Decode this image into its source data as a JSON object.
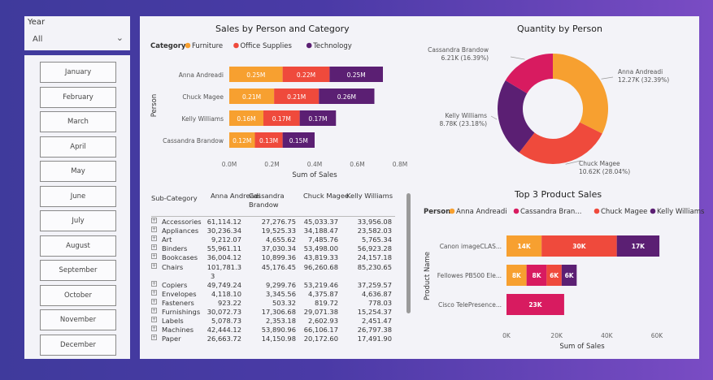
{
  "slicers": {
    "year": {
      "label": "Year",
      "selected": "All"
    },
    "months": [
      "January",
      "February",
      "March",
      "April",
      "May",
      "June",
      "July",
      "August",
      "September",
      "October",
      "November",
      "December"
    ]
  },
  "colors": {
    "furniture": "#f7a030",
    "office_supplies": "#ef4a3c",
    "technology": "#5b1f73",
    "anna": "#f7a030",
    "cassandra": "#d81b60",
    "chuck": "#ef4a3c",
    "kelly": "#5b1f73"
  },
  "table": {
    "headers": [
      "Sub-Category",
      "Anna Andreadi",
      "Cassandra Brandow",
      "Chuck Magee",
      "Kelly Williams"
    ],
    "rows": [
      [
        "Accessories",
        "61,114.12",
        "27,276.75",
        "45,033.37",
        "33,956.08"
      ],
      [
        "Appliances",
        "30,236.34",
        "19,525.33",
        "34,188.47",
        "23,582.03"
      ],
      [
        "Art",
        "9,212.07",
        "4,655.62",
        "7,485.76",
        "5,765.34"
      ],
      [
        "Binders",
        "55,961.11",
        "37,030.34",
        "53,498.00",
        "56,923.28"
      ],
      [
        "Bookcases",
        "36,004.12",
        "10,899.36",
        "43,819.33",
        "24,157.18"
      ],
      [
        "Chairs",
        "101,781.3",
        "45,176.45",
        "96,260.68",
        "85,230.65"
      ],
      [
        "",
        "3",
        "",
        "",
        ""
      ],
      [
        "Copiers",
        "49,749.24",
        "9,299.76",
        "53,219.46",
        "37,259.57"
      ],
      [
        "Envelopes",
        "4,118.10",
        "3,345.56",
        "4,375.87",
        "4,636.87"
      ],
      [
        "Fasteners",
        "923.22",
        "503.32",
        "819.72",
        "778.03"
      ],
      [
        "Furnishings",
        "30,072.73",
        "17,306.68",
        "29,071.38",
        "15,254.37"
      ],
      [
        "Labels",
        "5,078.73",
        "2,353.18",
        "2,602.93",
        "2,451.47"
      ],
      [
        "Machines",
        "42,444.12",
        "53,890.96",
        "66,106.17",
        "26,797.38"
      ],
      [
        "Paper",
        "26,663.72",
        "14,150.98",
        "20,172.60",
        "17,491.90"
      ]
    ]
  },
  "chart_data": [
    {
      "type": "bar",
      "orientation": "horizontal",
      "stacked": true,
      "title": "Sales by Person and Category",
      "legend_title": "Category",
      "legend_position": "top-left",
      "ylabel": "Person",
      "xlabel": "Sum of Sales",
      "categories": [
        "Anna Andreadi",
        "Chuck Magee",
        "Kelly Williams",
        "Cassandra Brandow"
      ],
      "series": [
        {
          "name": "Furniture",
          "values": [
            0.25,
            0.21,
            0.16,
            0.12
          ],
          "labels": [
            "0.25M",
            "0.21M",
            "0.16M",
            "0.12M"
          ]
        },
        {
          "name": "Office Supplies",
          "values": [
            0.22,
            0.21,
            0.17,
            0.13
          ],
          "labels": [
            "0.22M",
            "0.21M",
            "0.17M",
            "0.13M"
          ]
        },
        {
          "name": "Technology",
          "values": [
            0.25,
            0.26,
            0.17,
            0.15
          ],
          "labels": [
            "0.25M",
            "0.26M",
            "0.17M",
            "0.15M"
          ]
        }
      ],
      "xlim": [
        0,
        0.8
      ],
      "xticks": [
        "0.0M",
        "0.2M",
        "0.4M",
        "0.6M",
        "0.8M"
      ],
      "grid": false
    },
    {
      "type": "pie",
      "donut": true,
      "title": "Quantity by Person",
      "slices": [
        {
          "name": "Anna Andreadi",
          "value": 12.27,
          "label": "12.27K (32.39%)"
        },
        {
          "name": "Chuck Magee",
          "value": 10.62,
          "label": "10.62K (28.04%)"
        },
        {
          "name": "Kelly Williams",
          "value": 8.78,
          "label": "8.78K (23.18%)"
        },
        {
          "name": "Cassandra Brandow",
          "value": 6.21,
          "label": "6.21K (16.39%)"
        }
      ]
    },
    {
      "type": "bar",
      "orientation": "horizontal",
      "stacked": true,
      "title": "Top 3 Product Sales",
      "legend_title": "Person",
      "legend_position": "top-left",
      "legend_entries": [
        "Anna Andreadi",
        "Cassandra Bran...",
        "Chuck Magee",
        "Kelly Williams"
      ],
      "ylabel": "Product Name",
      "xlabel": "Sum of Sales",
      "categories": [
        "Canon imageCLAS...",
        "Fellowes PB500 Ele...",
        "Cisco TelePresence..."
      ],
      "segments": [
        [
          {
            "person": "Anna Andreadi",
            "value": 14,
            "label": "14K"
          },
          {
            "person": "Chuck Magee",
            "value": 30,
            "label": "30K"
          },
          {
            "person": "Kelly Williams",
            "value": 17,
            "label": "17K"
          }
        ],
        [
          {
            "person": "Anna Andreadi",
            "value": 8,
            "label": "8K"
          },
          {
            "person": "Cassandra Brandow",
            "value": 8,
            "label": "8K"
          },
          {
            "person": "Chuck Magee",
            "value": 6,
            "label": "6K"
          },
          {
            "person": "Kelly Williams",
            "value": 6,
            "label": "6K"
          }
        ],
        [
          {
            "person": "Cassandra Brandow",
            "value": 23,
            "label": "23K"
          }
        ]
      ],
      "xlim": [
        0,
        60
      ],
      "xticks": [
        "0K",
        "20K",
        "40K",
        "60K"
      ],
      "grid": false
    }
  ]
}
